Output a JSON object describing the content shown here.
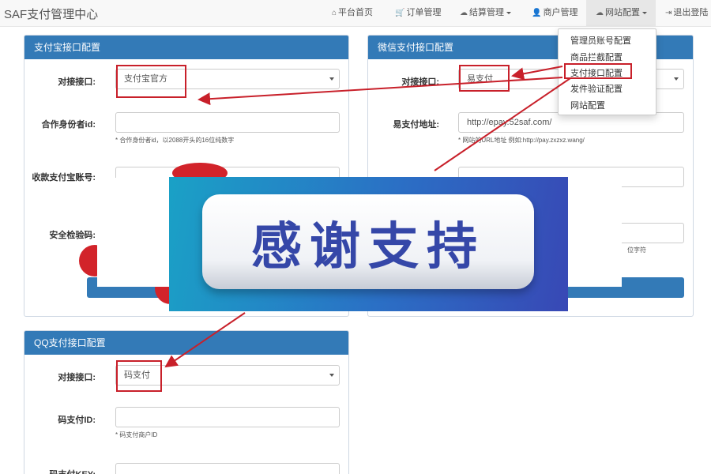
{
  "navbar": {
    "brand": "SAF支付管理中心",
    "items": [
      {
        "icon": "home-icon",
        "label": "平台首页"
      },
      {
        "icon": "cart-icon",
        "label": "订单管理"
      },
      {
        "icon": "cloud-icon",
        "label": "结算管理"
      },
      {
        "icon": "user-icon",
        "label": "商户管理"
      },
      {
        "icon": "cloud-icon",
        "label": "网站配置"
      },
      {
        "icon": "logout-icon",
        "label": "退出登陆"
      }
    ]
  },
  "dropdown": {
    "items": [
      "管理员账号配置",
      "商品拦截配置",
      "支付接口配置",
      "发件验证配置",
      "网站配置"
    ]
  },
  "alipay": {
    "title": "支付宝接口配置",
    "interface_label": "对接接口:",
    "interface_value": "支付宝官方",
    "partner_label": "合作身份者id:",
    "partner_help": "* 合作身份者id，以2088开头的16位纯数字",
    "account_label": "收款支付宝账号:",
    "security_label": "安全检验码:"
  },
  "wechat": {
    "title": "微信支付接口配置",
    "interface_label": "对接接口:",
    "interface_value": "易支付",
    "url_label": "易支付地址:",
    "url_value": "http://epay.52saf.com/",
    "url_help": "* 网站的URL地址 例如:http://pay.zxzxz.wang/",
    "hint_tail": "位字符"
  },
  "qq": {
    "title": "QQ支付接口配置",
    "interface_label": "对接接口:",
    "interface_value": "码支付",
    "id_label": "码支付ID:",
    "id_help": "* 码支付商户ID",
    "key_label": "码支付KEY:"
  },
  "banner": {
    "text": "感谢支持"
  },
  "colors": {
    "panel_heading": "#337ab7",
    "annotation_red": "#c8202a",
    "banner_text": "#3547a8"
  }
}
